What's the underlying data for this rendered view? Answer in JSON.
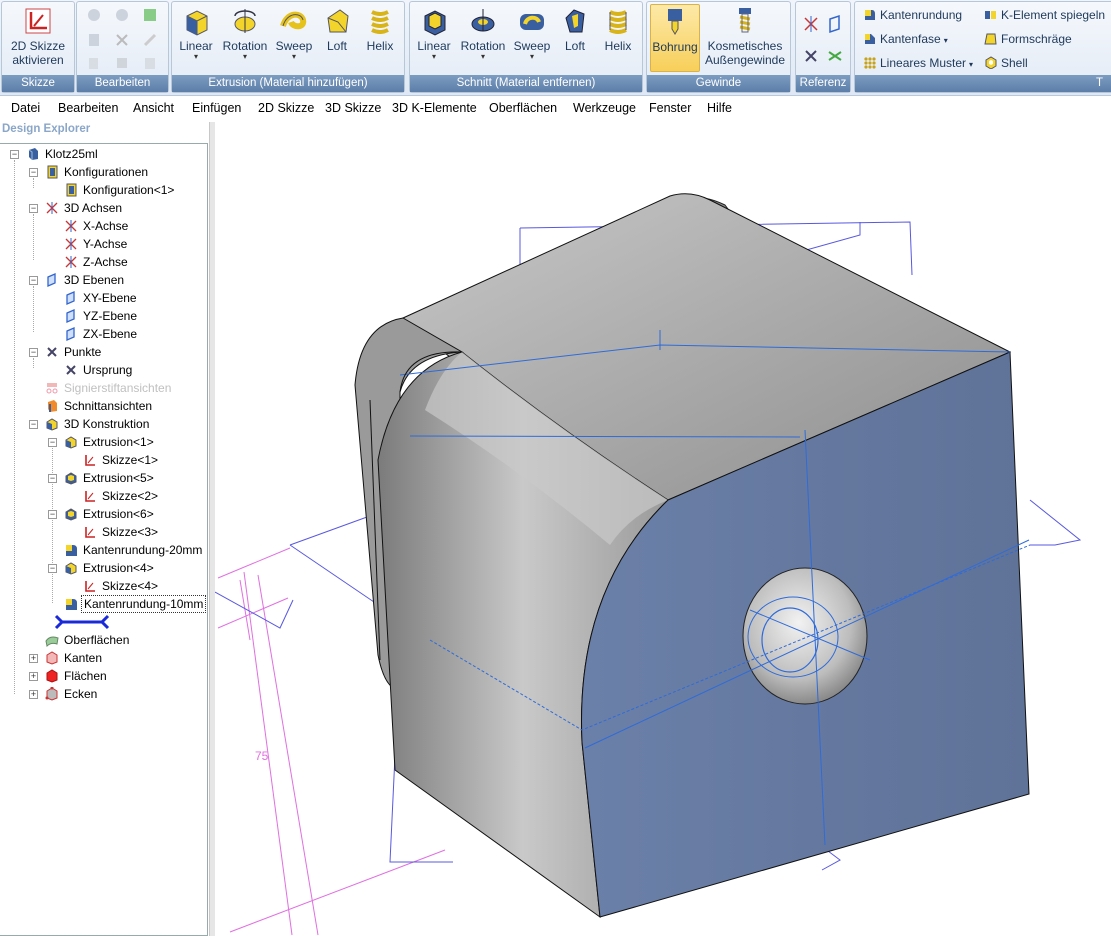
{
  "ribbon": {
    "skizze": {
      "button": "2D Skizze aktivieren",
      "label": "Skizze"
    },
    "bearbeiten": {
      "label": "Bearbeiten"
    },
    "extrusion": {
      "label": "Extrusion (Material hinzufügen)",
      "buttons": [
        "Linear",
        "Rotation",
        "Sweep",
        "Loft",
        "Helix"
      ]
    },
    "schnitt": {
      "label": "Schnitt (Material entfernen)",
      "buttons": [
        "Linear",
        "Rotation",
        "Sweep",
        "Loft",
        "Helix"
      ]
    },
    "gewinde": {
      "label": "Gewinde",
      "bohrung": "Bohrung",
      "kosmetisch": "Kosmetisches Außengewinde"
    },
    "referenz": {
      "label": "Referenz"
    },
    "features": {
      "kantenrundung": "Kantenrundung",
      "kantenfase": "Kantenfase",
      "lineares_muster": "Lineares Muster",
      "spiegeln": "K-Element spiegeln",
      "formschraege": "Formschräge",
      "shell": "Shell",
      "cut_label": "T"
    }
  },
  "menu": [
    "Datei",
    "Bearbeiten",
    "Ansicht",
    "Einfügen",
    "2D Skizze",
    "3D Skizze",
    "3D K-Elemente",
    "Oberflächen",
    "Werkzeuge",
    "Fenster",
    "Hilfe"
  ],
  "explorer": {
    "title": "Design Explorer",
    "tree": [
      "Klotz25ml",
      "Konfigurationen",
      "Konfiguration<1>",
      "3D Achsen",
      "X-Achse",
      "Y-Achse",
      "Z-Achse",
      "3D Ebenen",
      "XY-Ebene",
      "YZ-Ebene",
      "ZX-Ebene",
      "Punkte",
      "Ursprung",
      "Signierstiftansichten",
      "Schnittansichten",
      "3D Konstruktion",
      "Extrusion<1>",
      "Skizze<1>",
      "Extrusion<5>",
      "Skizze<2>",
      "Extrusion<6>",
      "Skizze<3>",
      "Kantenrundung-20mm",
      "Extrusion<4>",
      "Skizze<4>",
      "Kantenrundung-10mm",
      "",
      "Oberflächen",
      "Kanten",
      "Flächen",
      "Ecken"
    ]
  },
  "viewport": {
    "dimension": "75"
  },
  "colors": {
    "accent": "#5c7ea8",
    "face": "#6b80a6",
    "body": "#a8a8a8",
    "sketch": "#4a4ad8",
    "dim": "#e070e0"
  }
}
